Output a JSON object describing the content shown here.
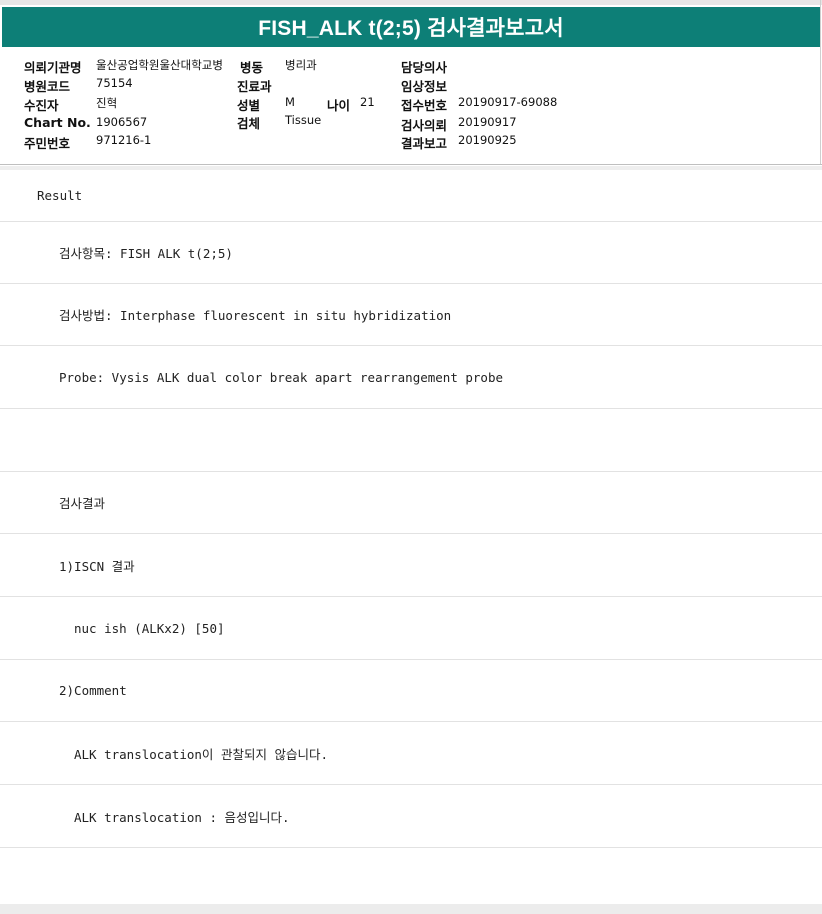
{
  "report": {
    "title": "FISH_ALK t(2;5) 검사결과보고서"
  },
  "meta": {
    "institution_label": "의뢰기관명",
    "institution_value": "울산공업학원울산대학교병",
    "ward_label": "병동",
    "ward_value": "병리과",
    "doctor_label": "담당의사",
    "hospital_code_label": "병원코드",
    "hospital_code_value": "75154",
    "department_label": "진료과",
    "clinical_info_label": "임상정보",
    "recipient_label": "수진자",
    "recipient_value": "진혁",
    "sex_label": "성별",
    "sex_value": "M",
    "age_label": "나이",
    "age_value": "21",
    "receipt_no_label": "접수번호",
    "receipt_no_value": "20190917-69088",
    "chart_no_label": "Chart No.",
    "chart_no_value": "1906567",
    "specimen_label": "검체",
    "specimen_value": "Tissue",
    "request_label": "검사의뢰",
    "request_value": "20190917",
    "resident_no_label": "주민번호",
    "resident_no_value": "971216-1",
    "report_label": "결과보고",
    "report_value": "20190925"
  },
  "rows": [
    "Result",
    "검사항목: FISH ALK t(2;5)",
    "검사방법: Interphase fluorescent in situ hybridization",
    "Probe: Vysis ALK dual color break apart rearrangement probe",
    "",
    "검사결과",
    "1)ISCN 결과",
    "nuc ish (ALKx2) [50]",
    "2)Comment",
    "ALK translocation이 관찰되지 않습니다.",
    "ALK translocation : 음성입니다."
  ]
}
